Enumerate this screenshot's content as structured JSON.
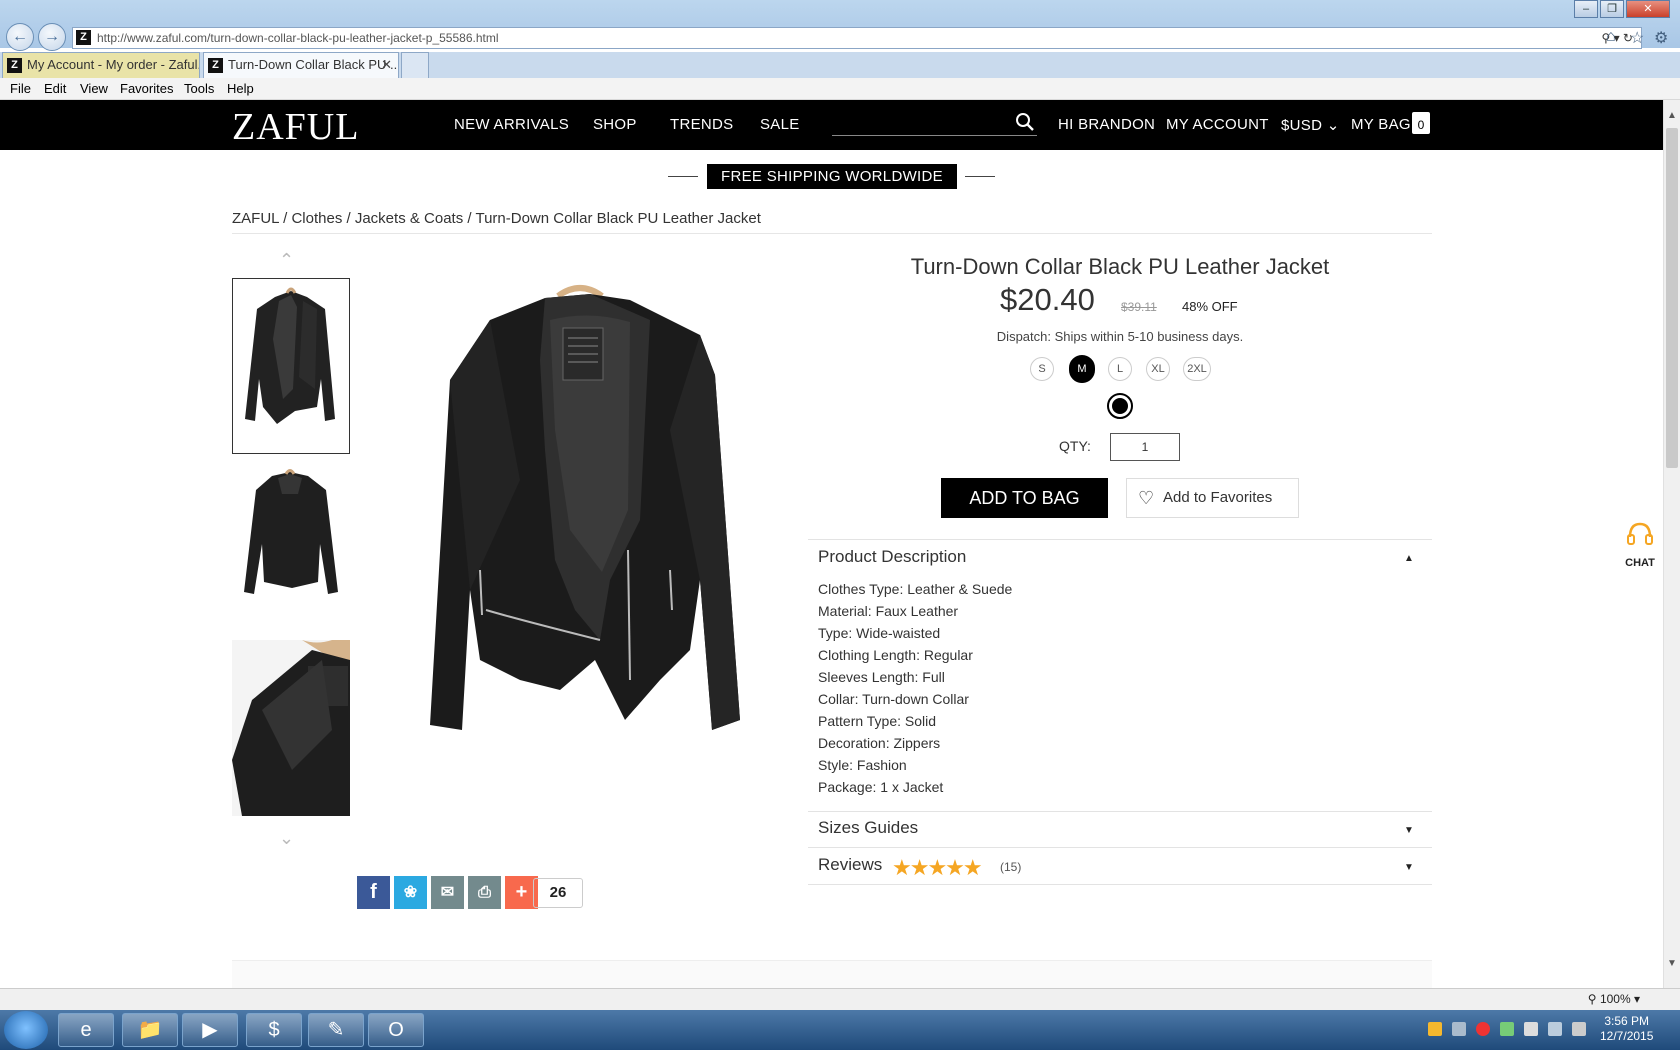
{
  "browser": {
    "url": "http://www.zaful.com/turn-down-collar-black-pu-leather-jacket-p_55586.html",
    "tabs": [
      {
        "label": "My Account - My order - Zaful..."
      },
      {
        "label": "Turn-Down Collar Black PU ..."
      }
    ],
    "menu": [
      "File",
      "Edit",
      "View",
      "Favorites",
      "Tools",
      "Help"
    ],
    "zoom": "100%"
  },
  "site": {
    "logo": "ZAFUL",
    "nav": [
      "NEW ARRIVALS",
      "SHOP",
      "TRENDS",
      "SALE"
    ],
    "greeting": "HI BRANDON",
    "account": "MY ACCOUNT",
    "currency": "$USD",
    "bag": "MY BAG",
    "bag_count": "0",
    "promo": "FREE SHIPPING WORLDWIDE",
    "chat": "CHAT"
  },
  "breadcrumb": [
    "ZAFUL",
    "Clothes",
    "Jackets & Coats",
    "Turn-Down Collar Black PU Leather Jacket"
  ],
  "product": {
    "title": "Turn-Down Collar Black PU Leather Jacket",
    "price": "$20.40",
    "old_price": "$39.11",
    "discount": "48% OFF",
    "dispatch": "Dispatch: Ships within 5-10 business days.",
    "sizes": [
      "S",
      "M",
      "L",
      "XL",
      "2XL"
    ],
    "selected_size": "M",
    "color": "#000000",
    "qty_label": "QTY:",
    "qty": "1",
    "add_to_bag": "ADD TO BAG",
    "favorite": "Add to Favorites"
  },
  "description": {
    "title": "Product Description",
    "lines": [
      "Clothes Type: Leather & Suede",
      "Material: Faux Leather",
      "Type: Wide-waisted",
      "Clothing Length: Regular",
      "Sleeves Length: Full",
      "Collar: Turn-down Collar",
      "Pattern Type: Solid",
      "Decoration: Zippers",
      "Style: Fashion",
      "Package: 1 x Jacket"
    ]
  },
  "sizes_guide": "Sizes Guides",
  "reviews": {
    "title": "Reviews",
    "rating": 5,
    "count": "(15)"
  },
  "share": {
    "count": "26",
    "colors": {
      "facebook": "#3b5998",
      "twitter": "#2ba9e1",
      "email": "#738a8d",
      "print": "#738a8d",
      "more": "#f8694d"
    }
  },
  "taskbar": {
    "time": "3:56 PM",
    "date": "12/7/2015"
  }
}
